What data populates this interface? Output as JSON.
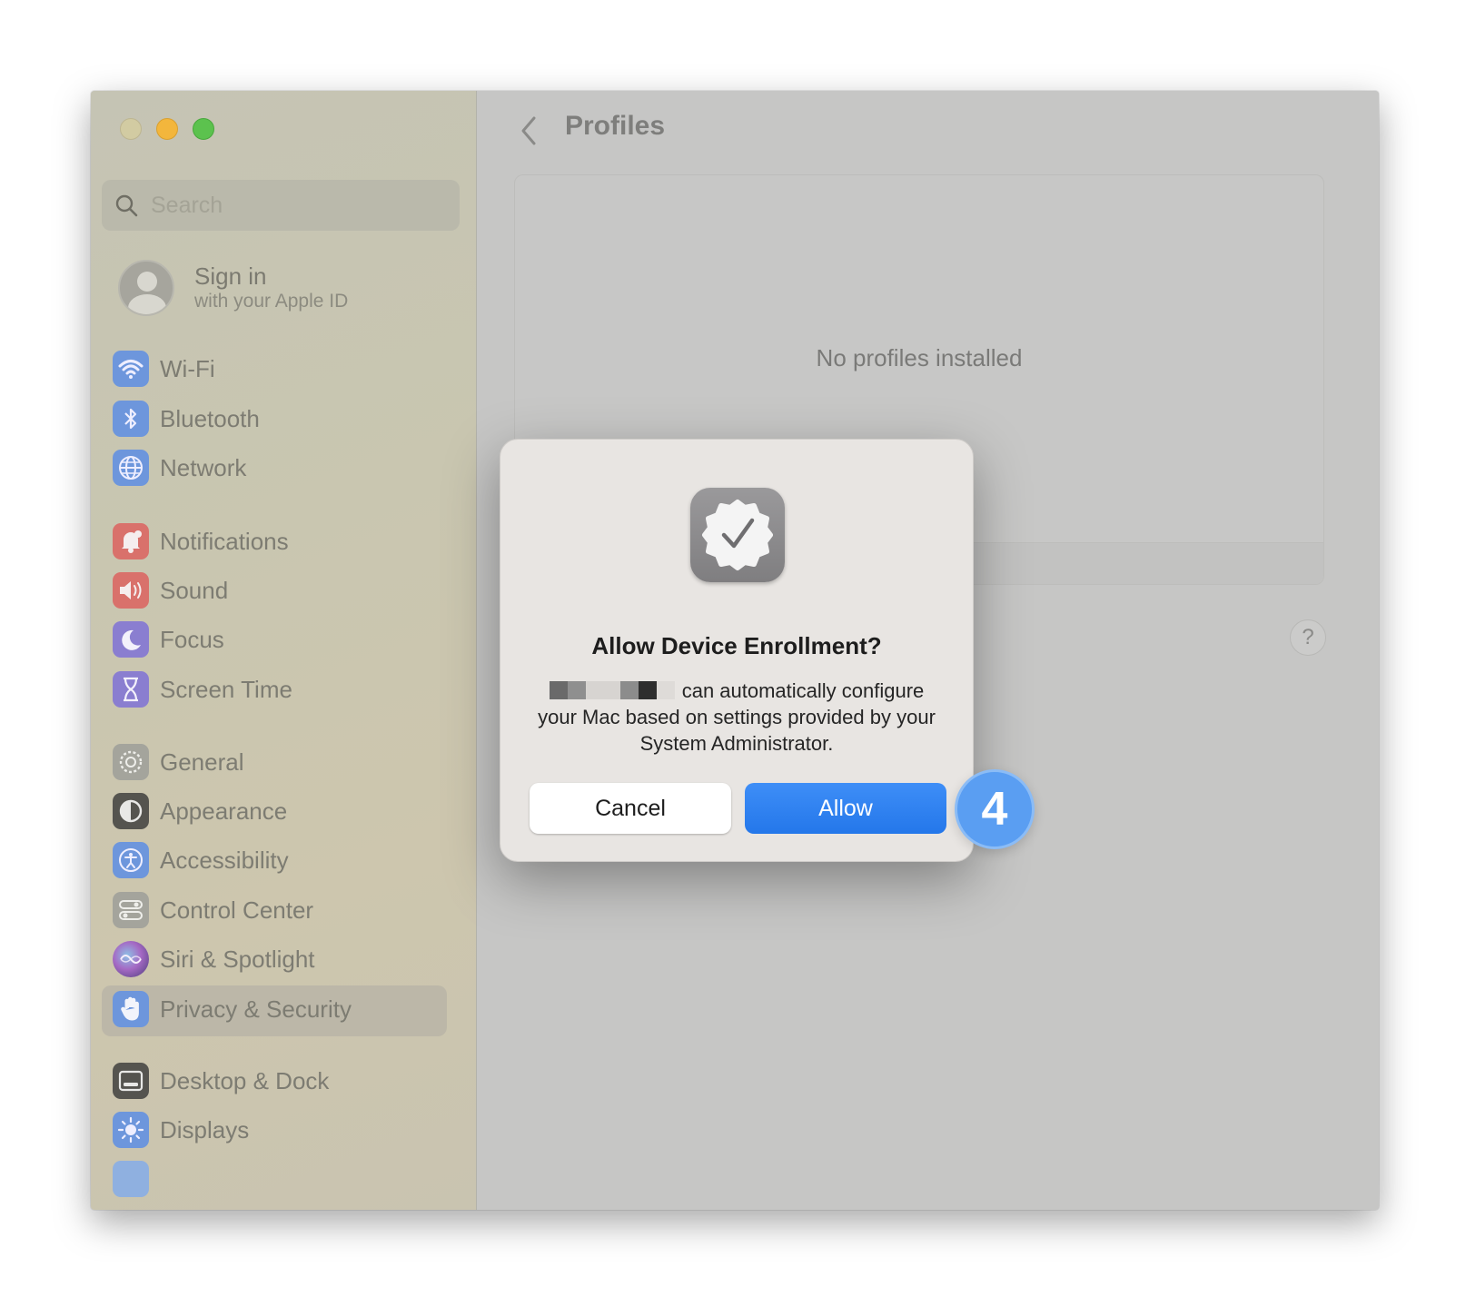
{
  "window": {
    "controls": [
      "close",
      "minimize",
      "maximize"
    ]
  },
  "sidebar": {
    "search": {
      "placeholder": "Search",
      "icon": "search-icon"
    },
    "account": {
      "title": "Sign in",
      "subtitle": "with your Apple ID"
    },
    "items": [
      {
        "label": "Wi-Fi",
        "icon": "wifi-icon",
        "color": "#5a8fe6"
      },
      {
        "label": "Bluetooth",
        "icon": "bluetooth-icon",
        "color": "#5a8fe6"
      },
      {
        "label": "Network",
        "icon": "globe-icon",
        "color": "#5a8fe6"
      },
      {
        "label": "Notifications",
        "icon": "bell-icon",
        "color": "#e0635f"
      },
      {
        "label": "Sound",
        "icon": "speaker-icon",
        "color": "#e0635f"
      },
      {
        "label": "Focus",
        "icon": "moon-icon",
        "color": "#7d6ad8"
      },
      {
        "label": "Screen Time",
        "icon": "hourglass-icon",
        "color": "#7d6ad8"
      },
      {
        "label": "General",
        "icon": "gear-icon",
        "color": "#9c9c9c"
      },
      {
        "label": "Appearance",
        "icon": "appearance-icon",
        "color": "#3a3a3a"
      },
      {
        "label": "Accessibility",
        "icon": "accessibility-icon",
        "color": "#5a8fe6"
      },
      {
        "label": "Control Center",
        "icon": "toggles-icon",
        "color": "#9c9c9c"
      },
      {
        "label": "Siri & Spotlight",
        "icon": "siri-icon",
        "color": "#9460c8"
      },
      {
        "label": "Privacy & Security",
        "icon": "hand-icon",
        "color": "#5a8fe6",
        "selected": true
      },
      {
        "label": "Desktop & Dock",
        "icon": "dock-icon",
        "color": "#3a3a3a"
      },
      {
        "label": "Displays",
        "icon": "sun-icon",
        "color": "#5a8fe6"
      }
    ]
  },
  "main": {
    "title": "Profiles",
    "empty_state": "No profiles installed",
    "help_label": "?"
  },
  "dialog": {
    "title": "Allow Device Enrollment?",
    "body": "can automatically configure your Mac based on settings provided by your System Administrator.",
    "cancel_label": "Cancel",
    "allow_label": "Allow",
    "icon": "badge-checkmark-icon"
  },
  "annotation": {
    "step": "4",
    "color": "#5a9ef2"
  }
}
